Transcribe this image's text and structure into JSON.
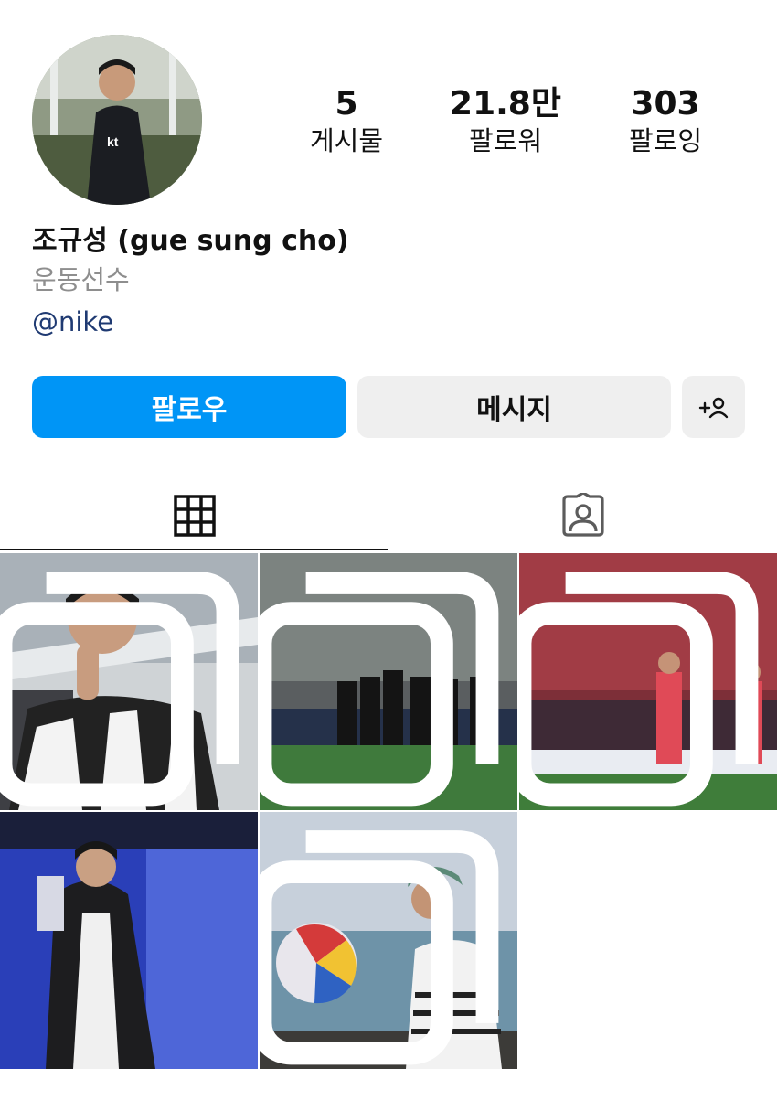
{
  "profile": {
    "avatar_icon": "profile-photo-avatar",
    "name": "조규성 (gue sung cho)",
    "category": "운동선수",
    "link": "@nike"
  },
  "stats": {
    "posts": {
      "value": "5",
      "label": "게시물"
    },
    "followers": {
      "value": "21.8만",
      "label": "팔로워"
    },
    "following": {
      "value": "303",
      "label": "팔로잉"
    }
  },
  "actions": {
    "follow_label": "팔로우",
    "message_label": "메시지",
    "add_user_icon": "add-person-icon"
  },
  "tabs": [
    {
      "icon": "grid-icon",
      "active": true
    },
    {
      "icon": "tagged-person-icon",
      "active": false
    }
  ],
  "posts": [
    {
      "icon": "photo-thumbnail",
      "multiple": true
    },
    {
      "icon": "photo-thumbnail",
      "multiple": true
    },
    {
      "icon": "photo-thumbnail",
      "multiple": true
    },
    {
      "icon": "photo-thumbnail",
      "multiple": false
    },
    {
      "icon": "photo-thumbnail",
      "multiple": true
    }
  ],
  "colors": {
    "accent": "#0095f6",
    "link": "#1f3a72",
    "muted": "#8e8e8e",
    "button_secondary": "#efefef"
  }
}
